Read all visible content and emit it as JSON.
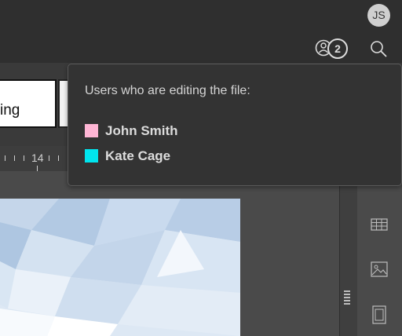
{
  "header": {
    "avatar_initials": "JS",
    "editing_users_count": "2"
  },
  "document": {
    "style_preview_text": "ing",
    "ruler_number": "14"
  },
  "editors_popup": {
    "title": "Users who are editing the file:",
    "users": [
      {
        "name": "John Smith",
        "color": "#ffb6d5"
      },
      {
        "name": "Kate Cage",
        "color": "#00e5ee"
      }
    ]
  },
  "right_toolbar": {
    "icons": [
      "table-icon",
      "image-icon",
      "page-layout-icon"
    ]
  }
}
